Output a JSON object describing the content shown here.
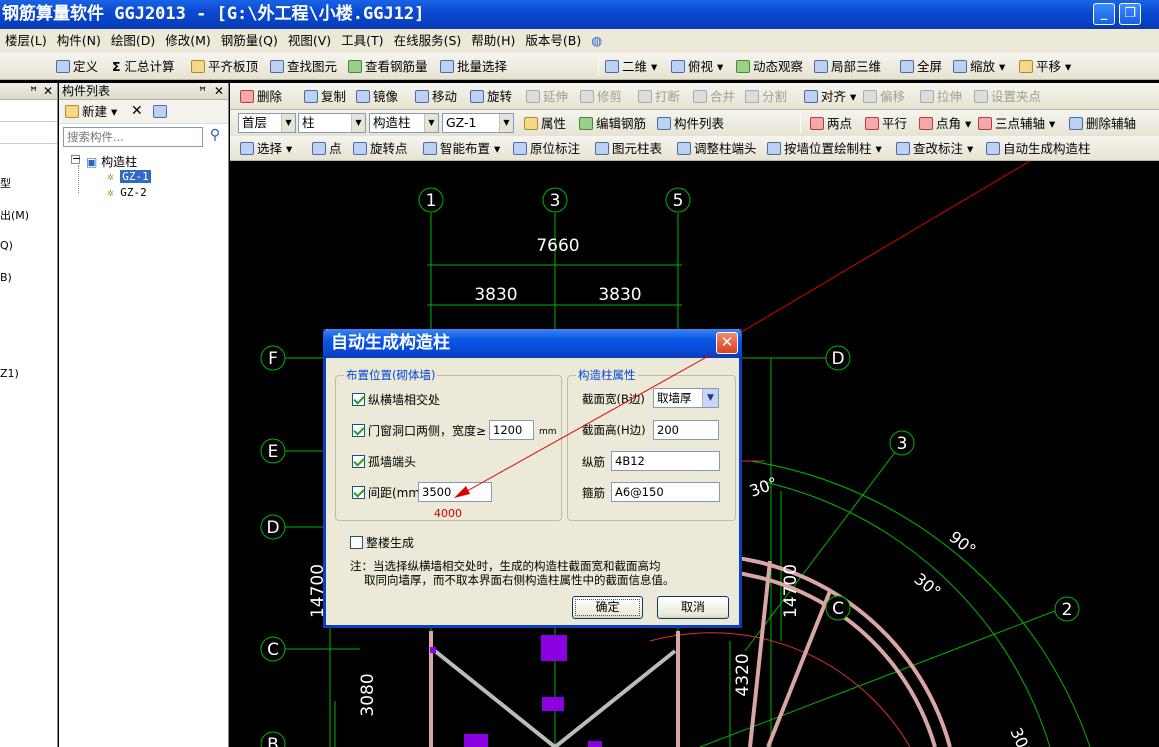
{
  "window": {
    "title": "钢筋算量软件 GGJ2013 - [G:\\外工程\\小楼.GGJ12]",
    "min": "_",
    "max": "❐",
    "close": "✕"
  },
  "menu": [
    "楼层(L)",
    "构件(N)",
    "绘图(D)",
    "修改(M)",
    "钢筋量(Q)",
    "视图(V)",
    "工具(T)",
    "在线服务(S)",
    "帮助(H)",
    "版本号(B)"
  ],
  "toolbar1": {
    "define": "定义",
    "sum": "汇总计算",
    "flat": "平齐板顶",
    "find": "查找图元",
    "viewrebar": "查看钢筋量",
    "batch": "批量选择",
    "view2d": "二维",
    "topview": "俯视",
    "dyn": "动态观察",
    "local3d": "局部三维",
    "full": "全屏",
    "zoom": "缩放",
    "pan": "平移"
  },
  "toolbar2": {
    "delete": "删除",
    "copy": "复制",
    "mirror": "镜像",
    "move": "移动",
    "rotate": "旋转",
    "extend": "延伸",
    "trim": "修剪",
    "break": "打断",
    "merge": "合并",
    "split": "分割",
    "align": "对齐",
    "offset": "偏移",
    "stretch": "拉伸",
    "setpoint": "设置夹点"
  },
  "toolbar3": {
    "floor": "首层",
    "type": "柱",
    "subtype": "构造柱",
    "comp": "GZ-1",
    "props": "属性",
    "editrebar": "编辑钢筋",
    "complist": "构件列表",
    "twopt": "两点",
    "parallel": "平行",
    "angle": "点角",
    "threeaxis": "三点辅轴",
    "delaux": "删除辅轴"
  },
  "toolbar4": {
    "select": "选择",
    "point": "点",
    "rotpt": "旋转点",
    "smart": "智能布置",
    "insitu": "原位标注",
    "coltable": "图元柱表",
    "adjust": "调整柱端头",
    "bywall": "按墙位置绘制柱",
    "edit": "查改标注",
    "auto": "自动生成构造柱"
  },
  "leftpanel": {
    "pin": "ꟸ",
    "close": "✕",
    "items": [
      "型",
      "出(M)",
      "Q)",
      "B)",
      "Z1)"
    ]
  },
  "components": {
    "header": "构件列表",
    "pin": "ꟸ",
    "close": "✕",
    "new": "新建",
    "search_placeholder": "搜索构件...",
    "root": "构造柱",
    "children": [
      "GZ-1",
      "GZ-2"
    ]
  },
  "canvas": {
    "axes_top": [
      "1",
      "3",
      "5"
    ],
    "dim_total": "7660",
    "dim_a": "3830",
    "dim_b": "3830",
    "axes_left": [
      "F",
      "E",
      "D",
      "C",
      "B"
    ],
    "axis_right_d": "D",
    "axis_arc_c": "C",
    "axes_radial": [
      "3",
      "2"
    ],
    "angles": [
      "30°",
      "90°",
      "30°",
      "30°"
    ],
    "dim_left_v": "14700",
    "dim_mid_v": "14700",
    "dim_3080": "3080",
    "dim_4320": "4320"
  },
  "dialog": {
    "title": "自动生成构造柱",
    "group_left": "布置位置(砌体墙)",
    "opt1": "纵横墙相交处",
    "opt2": "门窗洞口两侧，宽度≥",
    "opt2_value": "1200",
    "opt2_unit": "mm",
    "opt3": "孤墙端头",
    "opt4": "间距(mm)",
    "opt4_value": "3500",
    "annotation": "4000",
    "group_right": "构造柱属性",
    "width_label": "截面宽(B边)",
    "width_value": "取墙厚",
    "height_label": "截面高(H边)",
    "height_value": "200",
    "long_label": "纵筋",
    "long_value": "4B12",
    "stirrup_label": "箍筋",
    "stirrup_value": "A6@150",
    "whole": "整楼生成",
    "note1": "注：当选择纵横墙相交处时，生成的构造柱截面宽和截面高均",
    "note2": "取同向墙厚，而不取本界面右侧构造柱属性中的截面信息值。",
    "ok": "确定",
    "cancel": "取消"
  }
}
